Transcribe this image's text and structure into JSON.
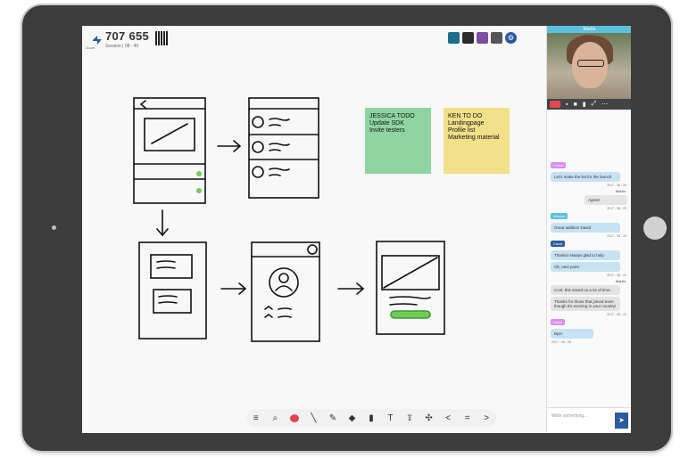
{
  "session": {
    "number": "707 655",
    "subtitle": "Session | 08 : 45",
    "logo_text": "Zoom"
  },
  "avatars": [
    "#1b6f8a",
    "#2b2b2b",
    "#7b4fa0",
    "#555555"
  ],
  "sticky_notes": [
    {
      "lines": [
        "JESSICA TODO",
        "Update SDK",
        "Invite testers"
      ],
      "color": "#8fd4a1"
    },
    {
      "lines": [
        "KEN TO DO",
        "Landingpage",
        "Profile list",
        "Marketing material"
      ],
      "color": "#f2e08a"
    }
  ],
  "toolbar": {
    "items": [
      "≡",
      "⌕",
      "●",
      "╲",
      "✎",
      "◆",
      "▮",
      "T",
      "⇪",
      "✣",
      "<",
      "=",
      ">"
    ]
  },
  "video": {
    "name": "Martin"
  },
  "chat": {
    "messages": [
      {
        "author": "Lorem",
        "text": "Let's make the list for the launch",
        "style": "blue",
        "stamp": "2017 - 08 - 29"
      },
      {
        "author": "Martin",
        "text": "Agree!",
        "style": "gray-right",
        "stamp": "2017 - 08 - 29"
      },
      {
        "author": "Marcus",
        "text": "Great addition David",
        "style": "blue",
        "stamp": "2017 - 08 - 29"
      },
      {
        "author": "David",
        "text": "Thanks! Always glad to help.",
        "style": "blue",
        "stamp": ""
      },
      {
        "author": "",
        "text": "Ok, next point",
        "style": "blue",
        "stamp": "2017 - 08 - 29"
      },
      {
        "author": "Martin",
        "text": "Cool, this saved us a lot of time.",
        "style": "gray",
        "stamp": ""
      },
      {
        "author": "",
        "text": "Thanks for those that joined even though it's evening in your country!",
        "style": "gray",
        "stamp": "2017 - 08 - 29"
      },
      {
        "author": "Laura",
        "text": "Bye!",
        "style": "blue",
        "stamp": "2017 - 08 - 29"
      }
    ],
    "input_placeholder": "Write something..."
  }
}
